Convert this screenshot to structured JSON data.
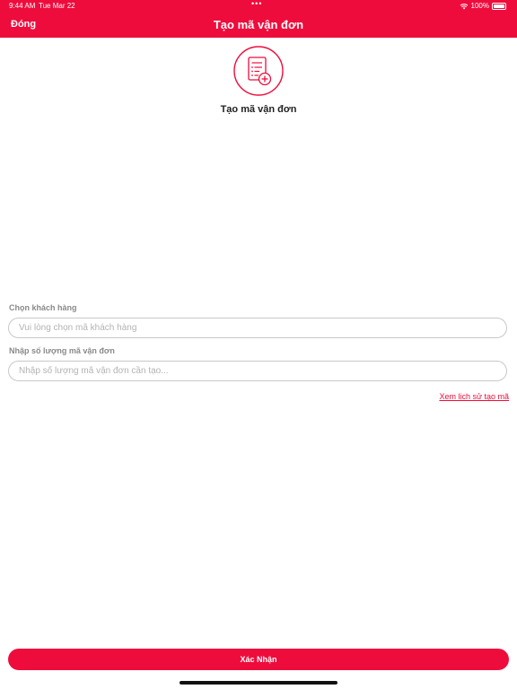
{
  "status_bar": {
    "time": "9:44 AM",
    "date": "Tue Mar 22",
    "dots": "•••",
    "battery": "100%"
  },
  "header": {
    "close_label": "Đóng",
    "title": "Tạo mã vận đơn"
  },
  "hero": {
    "icon": "document-add-icon",
    "label": "Tạo mã vận đơn"
  },
  "form": {
    "customer": {
      "label": "Chọn khách hàng",
      "value": "",
      "placeholder": "Vui lòng chọn mã khách hàng"
    },
    "quantity": {
      "label": "Nhập số lượng mã vận đơn",
      "value": "",
      "placeholder": "Nhập số lượng mã vận đơn cần tạo..."
    },
    "history_link": "Xem lịch sử tạo mã"
  },
  "footer": {
    "confirm_label": "Xác Nhận"
  },
  "colors": {
    "accent": "#EE0C3C",
    "label_gray": "#8a8a8a",
    "border_gray": "#c8c8c8"
  }
}
